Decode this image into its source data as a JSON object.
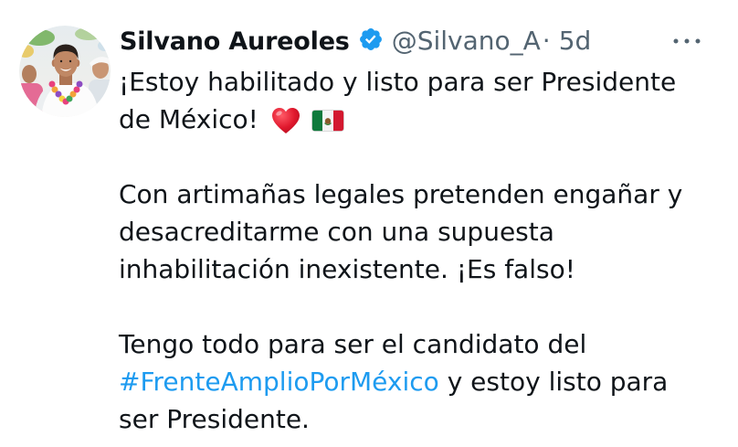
{
  "tweet": {
    "author": {
      "name": "Silvano Aureoles",
      "handle": "@Silvano_A",
      "avatar_icon": "avatar-photo",
      "verified": true,
      "verified_icon": "verified-badge-icon"
    },
    "separator": "·",
    "time": "5d",
    "more_icon": "more-horizontal-icon",
    "body": {
      "paragraphs": [
        {
          "lines": [
            "¡Estoy habilitado y listo para ser Presidente",
            "de México!"
          ],
          "emojis": [
            "heart-emoji",
            "mexico-flag-emoji"
          ]
        },
        {
          "lines": [
            "Con artimañas legales pretenden engañar y",
            "desacreditarme con una supuesta",
            "inhabilitación inexistente. ¡Es falso!"
          ]
        },
        {
          "lines": [
            "Tengo todo para ser el candidato del",
            " y estoy listo para",
            "ser Presidente."
          ],
          "hashtag": "#FrenteAmplioPorMéxico"
        }
      ]
    },
    "colors": {
      "text": "#0F1419",
      "secondary": "#536471",
      "link": "#1D9BF0",
      "verified": "#1D9BF0",
      "heart": "#E0182D",
      "flag_green": "#0F7A3C",
      "flag_white": "#F4F4F4",
      "flag_red": "#D3182F",
      "background": "#FFFFFF"
    }
  }
}
